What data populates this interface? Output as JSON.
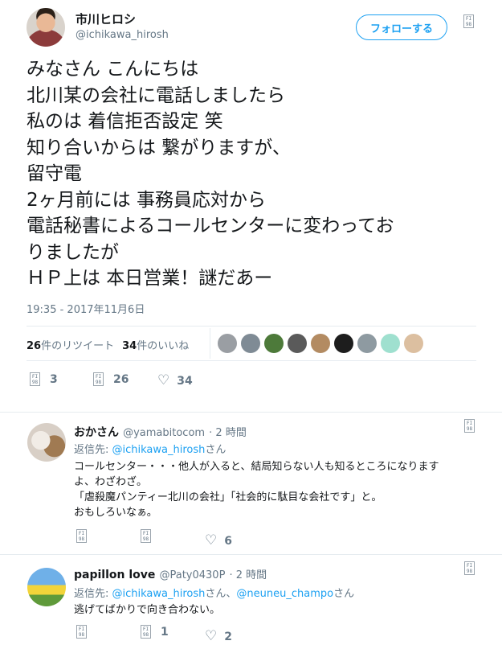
{
  "main_tweet": {
    "author_name": "市川ヒロシ",
    "author_handle": "@ichikawa_hirosh",
    "follow_label": "フォローする",
    "text_lines": [
      "みなさん こんにちは",
      "北川某の会社に電話しましたら",
      "私のは 着信拒否設定 笑",
      "知り合いからは 繋がりますが、",
      "留守電",
      "2ヶ月前には 事務員応対から",
      "電話秘書によるコールセンターに変わってお",
      "りましたが",
      "ＨＰ上は 本日営業！謎だあー"
    ],
    "timestamp": "19:35 - 2017年11月6日",
    "retweet_count": "26",
    "retweet_label": "件のリツイート",
    "like_count": "34",
    "like_label": "件のいいね",
    "action_reply_count": "3",
    "action_retweet_count": "26",
    "action_like_count": "34"
  },
  "fi_icon_text": "FI\n98",
  "replies": [
    {
      "name": "おかさん",
      "handle": "@yamabitocom",
      "time": "· 2 時間",
      "reply_to_prefix": "返信先: ",
      "reply_to": "@ichikawa_hirosh",
      "reply_to_suffix": "さん",
      "text_lines": [
        "コールセンター・・・他人が入ると、結局知らない人も知るところになります",
        "よ、わざわざ。",
        "「虐殺魔パンティー北川の会社」「社会的に駄目な会社です」と。",
        "おもしろいなぁ。"
      ],
      "like_count": "6"
    },
    {
      "name": "papillon love",
      "handle": "@Paty0430P",
      "time": "· 2 時間",
      "reply_to_prefix": "返信先: ",
      "reply_to": "@ichikawa_hirosh",
      "reply_to_sep": "さん、",
      "reply_to_2": "@neuneu_champo",
      "reply_to_suffix": "さん",
      "text_lines": [
        "逃げてばかりで向き合わない。"
      ],
      "retweet_count": "1",
      "like_count": "2"
    }
  ],
  "colors": {
    "accent": "#1da1f2",
    "muted": "#657786",
    "divider": "#e6ecf0"
  },
  "icons": [
    "fi-icon",
    "heart-icon"
  ]
}
